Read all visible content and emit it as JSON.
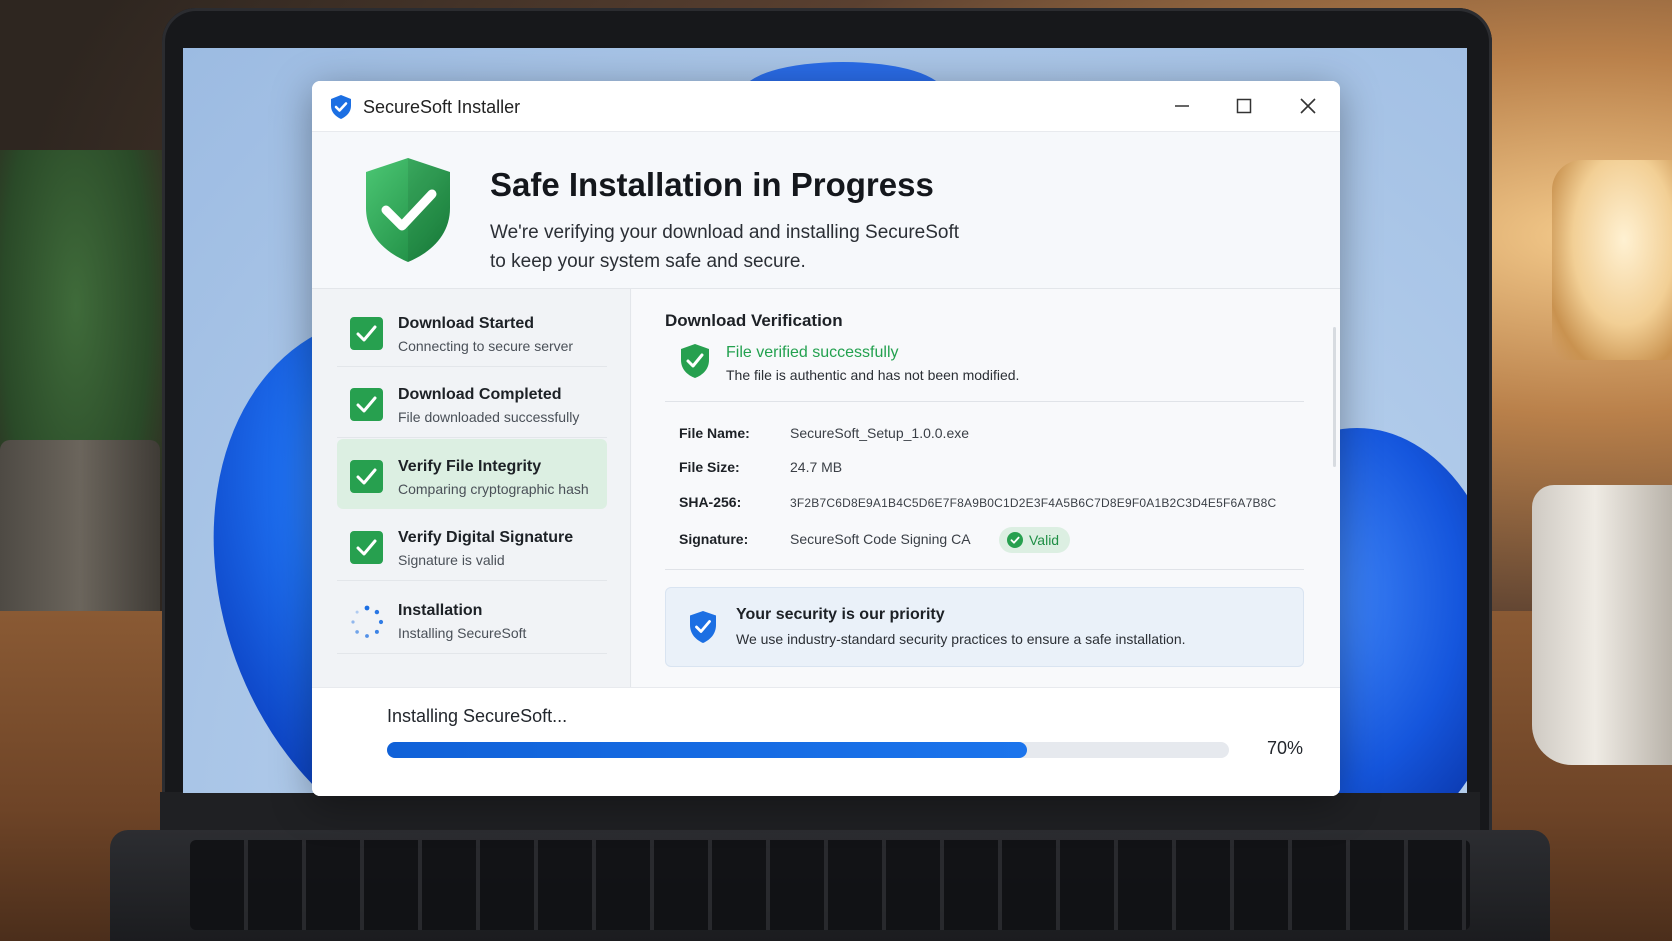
{
  "window": {
    "title": "SecureSoft Installer"
  },
  "hero": {
    "title": "Safe Installation in Progress",
    "subtitle_line1": "We're verifying your download and installing SecureSoft",
    "subtitle_line2": "to keep your system safe and secure."
  },
  "steps": [
    {
      "title": "Download Started",
      "subtitle": "Connecting to secure server",
      "status": "complete"
    },
    {
      "title": "Download Completed",
      "subtitle": "File downloaded successfully",
      "status": "complete"
    },
    {
      "title": "Verify File Integrity",
      "subtitle": "Comparing cryptographic hash",
      "status": "complete",
      "active": true
    },
    {
      "title": "Verify Digital Signature",
      "subtitle": "Signature is valid",
      "status": "complete"
    },
    {
      "title": "Installation",
      "subtitle": "Installing SecureSoft",
      "status": "in-progress"
    }
  ],
  "verification": {
    "heading": "Download Verification",
    "status_title": "File verified successfully",
    "status_subtitle": "The file is authentic and has not been modified.",
    "file_name_label": "File Name:",
    "file_name": "SecureSoft_Setup_1.0.0.exe",
    "file_size_label": "File Size:",
    "file_size": "24.7 MB",
    "sha_label": "SHA-256:",
    "sha": "3F2B7C6D8E9A1B4C5D6E7F8A9B0C1D2E3F4A5B6C7D8E9F0A1B2C3D4E5F6A7B8C",
    "signature_label": "Signature:",
    "signature": "SecureSoft Code Signing CA",
    "signature_badge": "Valid"
  },
  "notice": {
    "title": "Your security is our priority",
    "text": "We use industry-standard security practices to ensure a safe installation."
  },
  "progress": {
    "label": "Installing SecureSoft...",
    "percent_text": "70%",
    "fraction": 0.76
  },
  "colors": {
    "accent_blue": "#1565e0",
    "success_green": "#27a04f"
  },
  "icons": [
    "shield-check-icon",
    "minimize-icon",
    "maximize-icon",
    "close-icon",
    "checkmark-icon",
    "spinner-icon"
  ]
}
